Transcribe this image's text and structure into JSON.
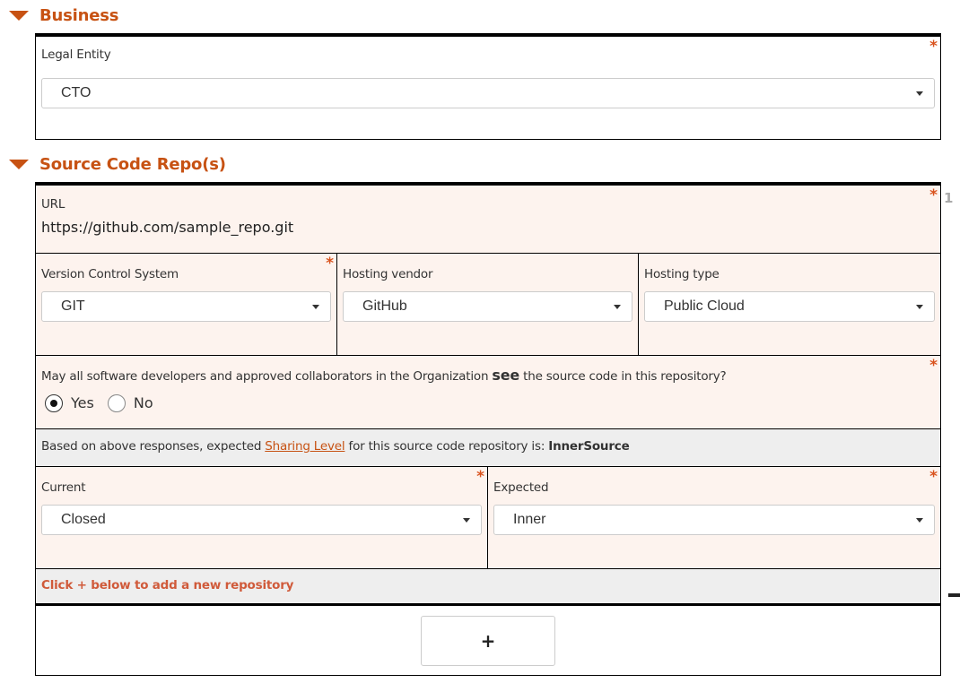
{
  "sections": {
    "business": {
      "title": "Business",
      "legal_entity": {
        "label": "Legal Entity",
        "required": "*",
        "value": "CTO"
      }
    },
    "repos": {
      "title": "Source Code Repo(s)",
      "index": "1",
      "url": {
        "label": "URL",
        "required": "*",
        "value": "https://github.com/sample_repo.git"
      },
      "version_control": {
        "label": "Version Control System",
        "required": "*",
        "value": "GIT"
      },
      "hosting_vendor": {
        "label": "Hosting vendor",
        "value": "GitHub"
      },
      "hosting_type": {
        "label": "Hosting type",
        "value": "Public Cloud"
      },
      "visibility_question": {
        "prefix": "May all software developers and approved collaborators in the Organization ",
        "emphasis": "see",
        "suffix": " the source code in this repository?",
        "required": "*",
        "options": [
          {
            "label": "Yes",
            "selected": true
          },
          {
            "label": "No",
            "selected": false
          }
        ]
      },
      "sharing_level_note": {
        "prefix": "Based on above responses, expected ",
        "link": "Sharing Level",
        "middle": " for this source code repository is: ",
        "value": "InnerSource"
      },
      "current": {
        "label": "Current",
        "required": "*",
        "value": "Closed"
      },
      "expected": {
        "label": "Expected",
        "required": "*",
        "value": "Inner"
      },
      "add_hint": "Click + below to add a new repository",
      "add_button": "+",
      "remove_button": "−"
    }
  },
  "colors": {
    "accent": "#c75213",
    "required": "#d9531e",
    "peach_bg": "#fdf3ee",
    "grey_bg": "#eeeeee"
  }
}
